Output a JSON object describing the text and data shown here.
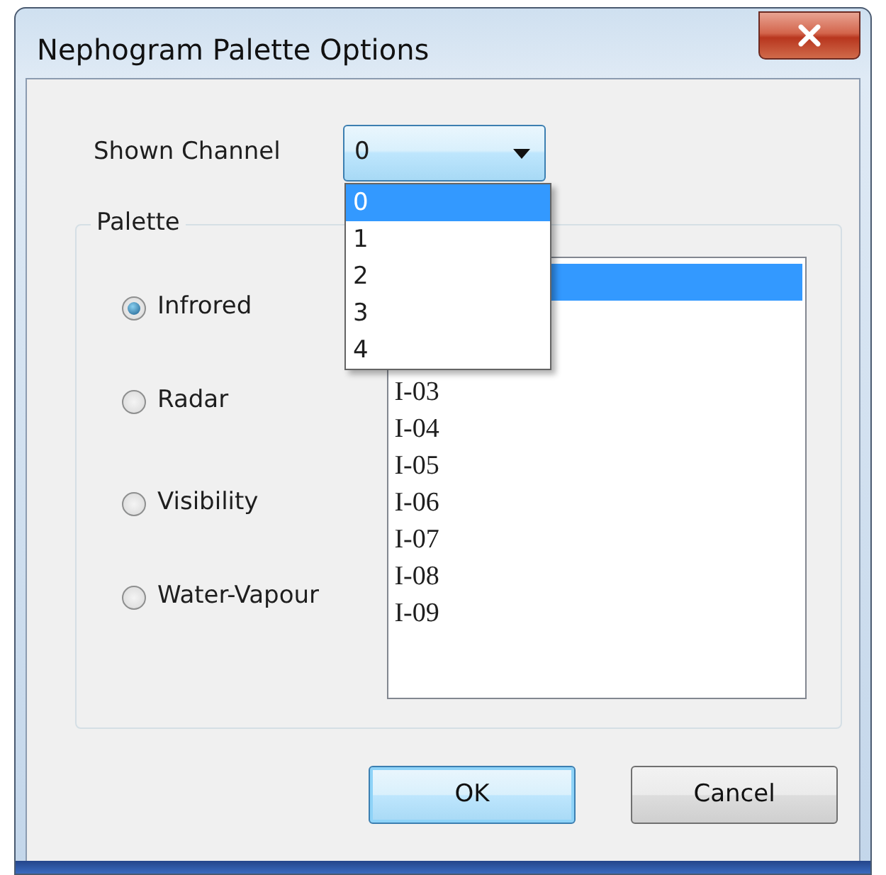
{
  "window": {
    "title": "Nephogram Palette Options"
  },
  "channel": {
    "label": "Shown Channel",
    "value": "0",
    "expanded": true,
    "options": [
      {
        "label": "0",
        "selected": true
      },
      {
        "label": "1",
        "selected": false
      },
      {
        "label": "2",
        "selected": false
      },
      {
        "label": "3",
        "selected": false
      },
      {
        "label": "4",
        "selected": false
      }
    ]
  },
  "palette": {
    "title": "Palette",
    "radios": [
      {
        "label": "Infrored",
        "selected": true
      },
      {
        "label": "Radar",
        "selected": false
      },
      {
        "label": "Visibility",
        "selected": false
      },
      {
        "label": "Water-Vapour",
        "selected": false
      }
    ],
    "list": {
      "items": [
        {
          "selected": true
        },
        {
          "label": "I-03",
          "selected": false
        },
        {
          "label": "I-04",
          "selected": false
        },
        {
          "label": "I-05",
          "selected": false
        },
        {
          "label": "I-06",
          "selected": false
        },
        {
          "label": "I-07",
          "selected": false
        },
        {
          "label": "I-08",
          "selected": false
        },
        {
          "label": "I-09",
          "selected": false
        }
      ]
    }
  },
  "buttons": [
    {
      "label": "OK",
      "default": true
    },
    {
      "label": "Cancel",
      "default": false
    }
  ]
}
